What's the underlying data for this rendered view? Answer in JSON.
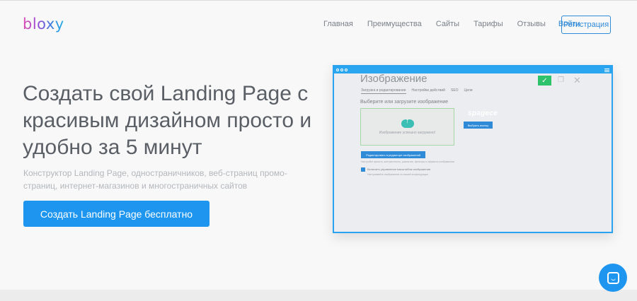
{
  "brand": {
    "logo": "bloxy"
  },
  "nav": {
    "items": [
      "Главная",
      "Преимущества",
      "Сайты",
      "Тарифы",
      "Отзывы"
    ],
    "login": "Войти",
    "register": "Регистрация"
  },
  "hero": {
    "title": "Создать свой Landing Page с красивым дизайном просто и удобно за 5 минут",
    "subtitle": "Конструктор Landing Page, одностраничников, веб-страниц промо-страниц, интернет-магазинов и многостраничных сайтов",
    "cta": "Создать Landing Page бесплатно"
  },
  "mockup": {
    "title": "Изображение",
    "tabs": [
      "Загрузка и редактирование",
      "Настройки действий",
      "SEO",
      "Цели"
    ],
    "choose_label": "Выберите или загрузите изображение",
    "upload_text": "Изображение успешно загружено!",
    "watermark": "spagece",
    "pick_button": "Выбрать иконку",
    "edit_button": "Редактировать в редакторе изображений",
    "edit_hint": "Настройте яркость, контрастность, размытие, фильтры и эффекты изображения",
    "checkbox_label": "Включить управление масштабом изображения",
    "checkbox_hint": "Настраивайте изображение по вашей конфигурации",
    "icons": {
      "ok": "check-icon",
      "copy": "copy-icon",
      "close": "close-icon"
    }
  },
  "chat": {
    "icon": "chat-icon"
  },
  "colors": {
    "accent": "#1e96ef",
    "ok": "#2ec26b",
    "mock_border": "#29a3ef"
  }
}
